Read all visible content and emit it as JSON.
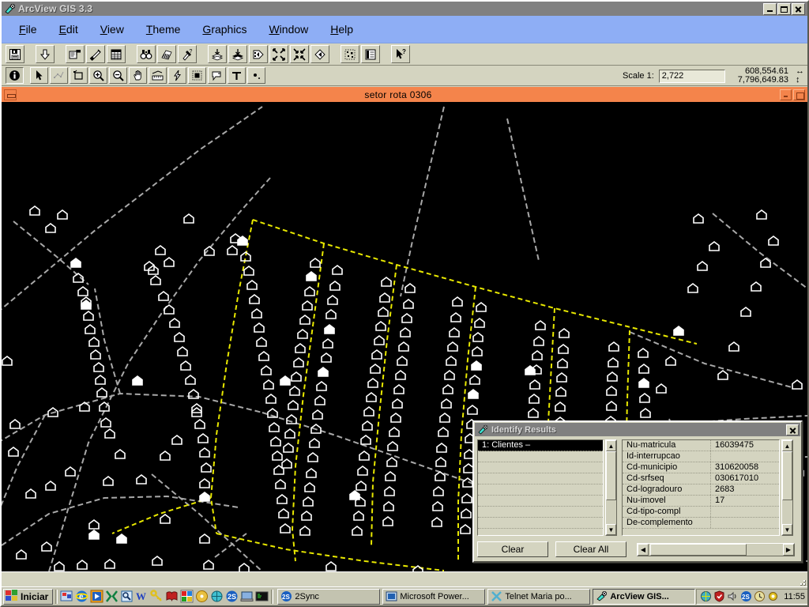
{
  "window": {
    "title": "ArcView GIS 3.3",
    "icon": "arcview-icon",
    "minimize_label": "",
    "maximize_label": "",
    "close_label": ""
  },
  "menu": {
    "items": [
      {
        "label": "File",
        "accel": "F"
      },
      {
        "label": "Edit",
        "accel": "E"
      },
      {
        "label": "View",
        "accel": "V"
      },
      {
        "label": "Theme",
        "accel": "T"
      },
      {
        "label": "Graphics",
        "accel": "G"
      },
      {
        "label": "Window",
        "accel": "W"
      },
      {
        "label": "Help",
        "accel": "H"
      }
    ]
  },
  "toolbar_main": {
    "tools": [
      {
        "name": "save-project-icon",
        "tip": "Save Project"
      },
      {
        "name": "add-theme-icon",
        "tip": "Add Theme"
      },
      {
        "name": "theme-properties-icon",
        "tip": "Theme Properties"
      },
      {
        "name": "edit-legend-icon",
        "tip": "Edit Legend"
      },
      {
        "name": "open-table-icon",
        "tip": "Open Theme Table"
      },
      {
        "name": "find-icon",
        "tip": "Find"
      },
      {
        "name": "locate-address-icon",
        "tip": "Locate Address"
      },
      {
        "name": "query-builder-icon",
        "tip": "Query Builder"
      },
      {
        "name": "zoom-to-themes-icon",
        "tip": "Zoom to Themes"
      },
      {
        "name": "zoom-to-selected-icon",
        "tip": "Zoom to Selected"
      },
      {
        "name": "zoom-to-full-extent-icon",
        "tip": "Zoom to Full Extent"
      },
      {
        "name": "zoom-in-fixed-icon",
        "tip": "Zoom In"
      },
      {
        "name": "zoom-out-fixed-icon",
        "tip": "Zoom Out"
      },
      {
        "name": "zoom-previous-icon",
        "tip": "Zoom to Previous Extent"
      },
      {
        "name": "select-feature-icon",
        "tip": "Select Feature"
      },
      {
        "name": "clear-selected-icon",
        "tip": "Clear Selected Features"
      },
      {
        "name": "help-pointer-icon",
        "tip": "Help"
      }
    ]
  },
  "toolbar_tools": {
    "tools": [
      {
        "name": "identify-icon",
        "tip": "Identify",
        "active": true
      },
      {
        "name": "pointer-icon",
        "tip": "Pointer",
        "active": false
      },
      {
        "name": "vertex-edit-icon",
        "tip": "Vertex Edit",
        "active": false
      },
      {
        "name": "select-shape-icon",
        "tip": "Select Feature",
        "active": false
      },
      {
        "name": "zoom-in-icon",
        "tip": "Zoom In",
        "active": false
      },
      {
        "name": "zoom-out-icon",
        "tip": "Zoom Out",
        "active": false
      },
      {
        "name": "pan-icon",
        "tip": "Pan",
        "active": false
      },
      {
        "name": "measure-icon",
        "tip": "Measure",
        "active": false
      },
      {
        "name": "hot-link-icon",
        "tip": "Hot Link",
        "active": false
      },
      {
        "name": "label-icon",
        "tip": "Label",
        "active": false
      },
      {
        "name": "callout-icon",
        "tip": "Callout",
        "active": false
      },
      {
        "name": "text-icon",
        "tip": "Text",
        "active": false
      },
      {
        "name": "draw-point-icon",
        "tip": "Draw Point",
        "active": false
      }
    ]
  },
  "scale": {
    "label": "Scale  1:",
    "value": "2,722",
    "coord_x": "608,554.61",
    "coord_y": "7,796,649.83",
    "x_arrow": "↔",
    "y_arrow": "↕"
  },
  "view": {
    "title": "setor rota 0306",
    "minimize_label": "",
    "maximize_label": ""
  },
  "map": {
    "background_color": "#000000",
    "street_color": "#a8a8a8",
    "route_color": "#e8e800",
    "house_color": "#ffffff"
  },
  "dialog": {
    "title": "Identify Results",
    "icon": "identify-icon",
    "close_label": "",
    "list": {
      "items": [
        {
          "label": "1:  Clientes –",
          "selected": true
        }
      ]
    },
    "fields": [
      {
        "name": "Nu-matricula",
        "value": "16039475"
      },
      {
        "name": "Id-interrupcao",
        "value": ""
      },
      {
        "name": "Cd-municipio",
        "value": "310620058"
      },
      {
        "name": "Cd-srfseq",
        "value": "030617010"
      },
      {
        "name": "Cd-logradouro",
        "value": "2683"
      },
      {
        "name": "Nu-imovel",
        "value": "17"
      },
      {
        "name": "Cd-tipo-compl",
        "value": ""
      },
      {
        "name": "De-complemento",
        "value": ""
      }
    ],
    "buttons": {
      "clear": "Clear",
      "clear_all": "Clear All"
    },
    "scroll": {
      "up_arrow": "▲",
      "down_arrow": "▼",
      "left_arrow": "◀",
      "right_arrow": "▶"
    }
  },
  "taskbar": {
    "start_label": "Iniciar",
    "quicklaunch": [
      {
        "name": "show-desktop-icon"
      },
      {
        "name": "internet-explorer-icon"
      },
      {
        "name": "media-player-icon"
      },
      {
        "name": "excel-icon"
      },
      {
        "name": "preview-icon"
      },
      {
        "name": "word-icon"
      },
      {
        "name": "key-icon"
      },
      {
        "name": "book-icon"
      },
      {
        "name": "paint-icon"
      },
      {
        "name": "cd-icon"
      },
      {
        "name": "network-icon"
      },
      {
        "name": "2sync-icon"
      },
      {
        "name": "laptop-icon"
      },
      {
        "name": "terminal-icon"
      }
    ],
    "tasks": [
      {
        "label": "2Sync",
        "icon": "2sync-icon",
        "active": false
      },
      {
        "label": "Microsoft Power...",
        "icon": "powerpoint-icon",
        "active": false
      },
      {
        "label": "Telnet Maria po...",
        "icon": "telnet-icon",
        "active": false
      },
      {
        "label": "ArcView GIS...",
        "icon": "arcview-icon",
        "active": true
      }
    ],
    "tray": [
      {
        "name": "network-tray-icon"
      },
      {
        "name": "antivirus-tray-icon"
      },
      {
        "name": "volume-tray-icon"
      },
      {
        "name": "2sync-tray-icon"
      },
      {
        "name": "scheduler-tray-icon"
      },
      {
        "name": "settings-tray-icon"
      }
    ],
    "clock": "11:55"
  }
}
